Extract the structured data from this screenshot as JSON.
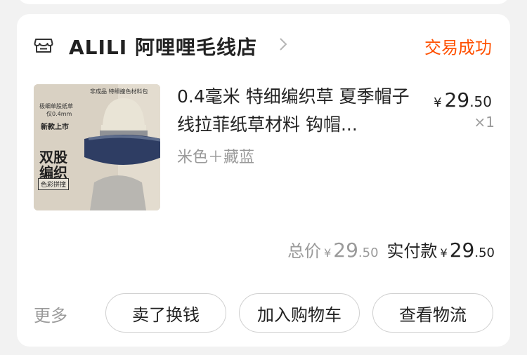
{
  "order": {
    "store_name": "ALILI 阿哩哩毛线店",
    "status": "交易成功",
    "icons": {
      "store": "store-icon",
      "chevron": "chevron-right-icon"
    },
    "accent_color": "#ff5000",
    "item": {
      "title": "0.4毫米 特细编织草 夏季帽子线拉菲纸草材料 钩帽...",
      "sku": "米色＋藏蓝",
      "price": {
        "currency": "¥",
        "integer": "29",
        "decimal": ".50"
      },
      "quantity": "×1",
      "image": {
        "top_label": "非成品 特细撞色材料包",
        "left_label_1": "极细单股纸草",
        "left_label_2": "仅0.4mm",
        "new_label": "新款上市",
        "big_1": "双股",
        "big_2": "编织",
        "tag": "色彩拼撞"
      }
    },
    "totals": {
      "total_label": "总价",
      "total": {
        "currency": "¥",
        "integer": "29",
        "decimal": ".50"
      },
      "paid_label": "实付款",
      "paid": {
        "currency": "¥",
        "integer": "29",
        "decimal": ".50"
      }
    },
    "actions": {
      "more": "更多",
      "sell": "卖了换钱",
      "add_cart": "加入购物车",
      "logistics": "查看物流"
    }
  }
}
